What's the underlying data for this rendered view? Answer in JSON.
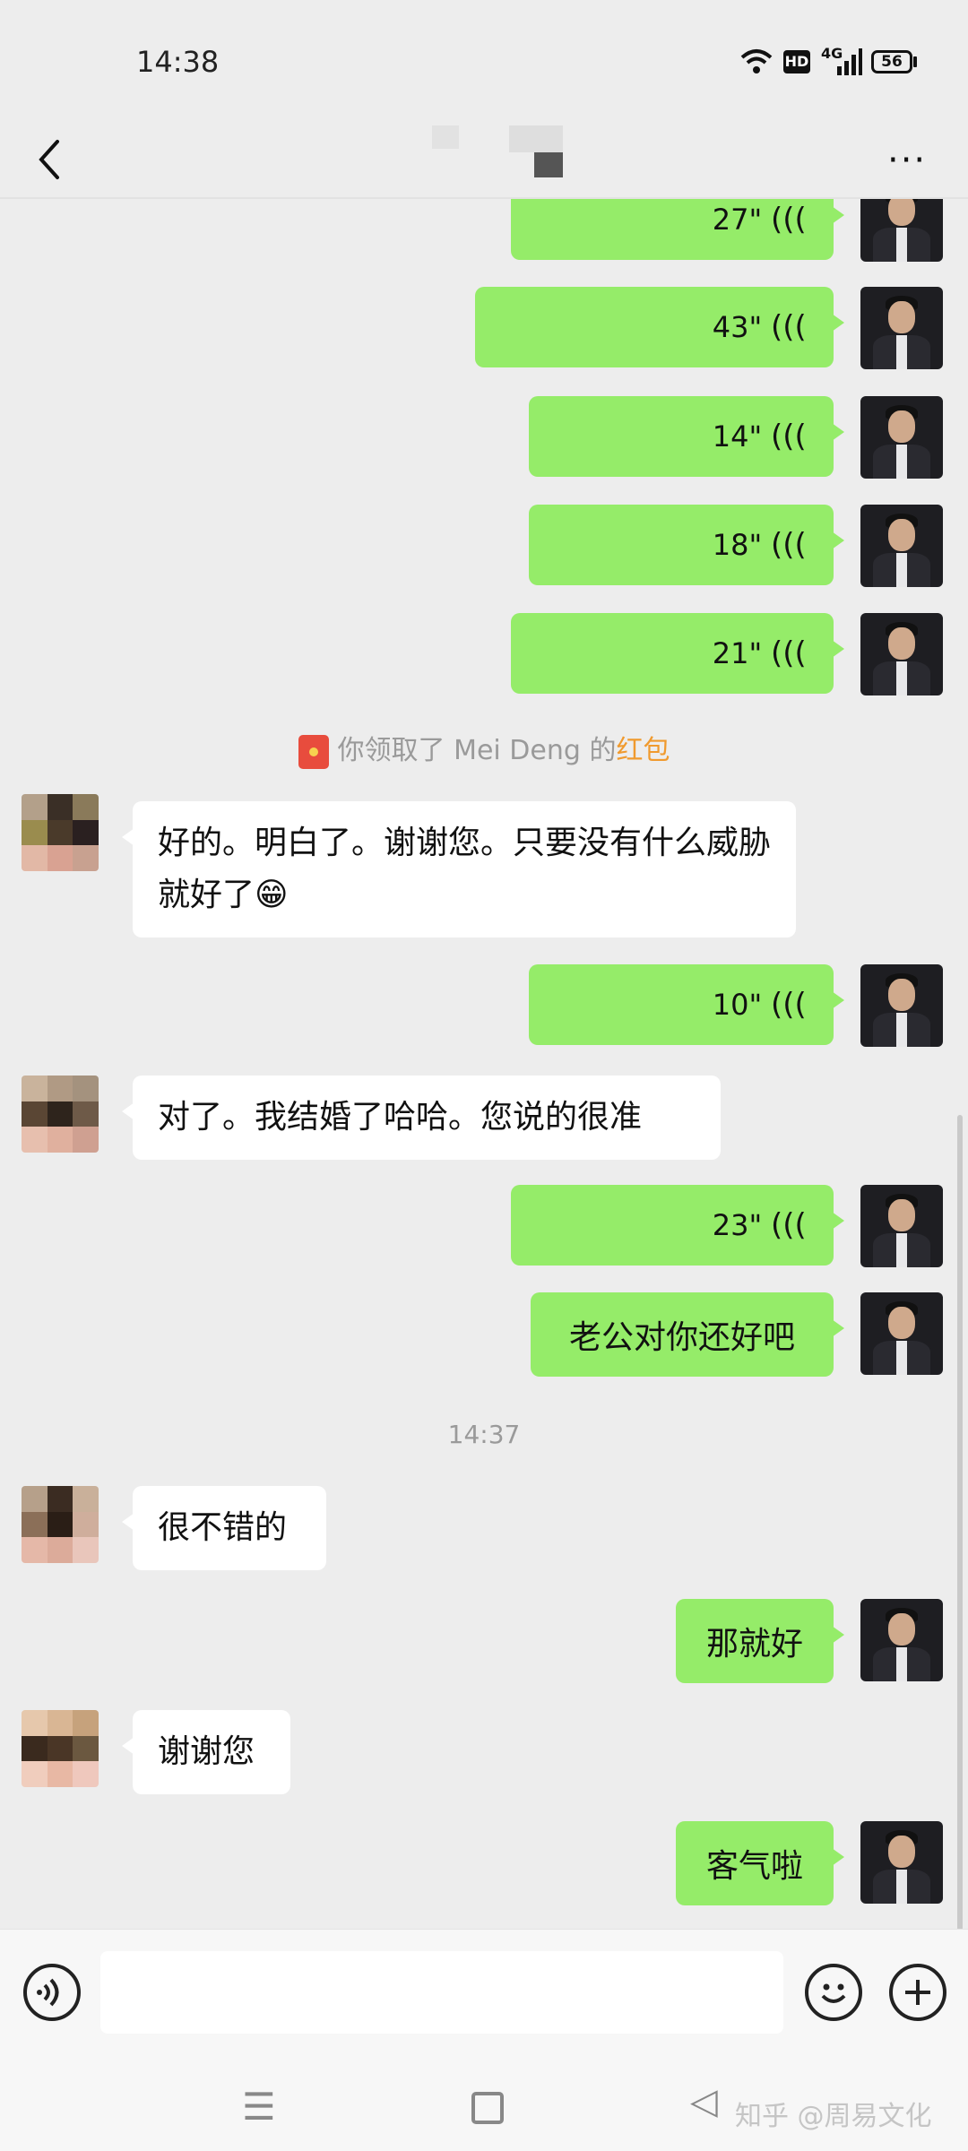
{
  "status_bar": {
    "time": "14:38",
    "hd": "HD",
    "network": "4G",
    "battery": "56"
  },
  "nav": {
    "back_icon": "chevron-left-icon",
    "more_icon": "more-dots-icon",
    "more_label": "···"
  },
  "messages": [
    {
      "side": "right",
      "type": "voice",
      "duration": "27\""
    },
    {
      "side": "right",
      "type": "voice",
      "duration": "43\""
    },
    {
      "side": "right",
      "type": "voice",
      "duration": "14\""
    },
    {
      "side": "right",
      "type": "voice",
      "duration": "18\""
    },
    {
      "side": "right",
      "type": "voice",
      "duration": "21\""
    },
    {
      "type": "system",
      "prefix": "你领取了 Mei Deng 的",
      "highlight": "红包"
    },
    {
      "side": "left",
      "type": "text",
      "text": "好的。明白了。谢谢您。只要没有什么威胁就好了😁"
    },
    {
      "side": "right",
      "type": "voice",
      "duration": "10\""
    },
    {
      "side": "left",
      "type": "text",
      "text": "对了。我结婚了哈哈。您说的很准"
    },
    {
      "side": "right",
      "type": "voice",
      "duration": "23\""
    },
    {
      "side": "right",
      "type": "text",
      "text": "老公对你还好吧"
    },
    {
      "type": "time",
      "text": "14:37"
    },
    {
      "side": "left",
      "type": "text",
      "text": "很不错的"
    },
    {
      "side": "right",
      "type": "text",
      "text": "那就好"
    },
    {
      "side": "left",
      "type": "text",
      "text": "谢谢您"
    },
    {
      "side": "right",
      "type": "text",
      "text": "客气啦"
    }
  ],
  "input_bar": {
    "voice_icon": "voice-input-icon",
    "emoji_icon": "emoji-icon",
    "plus_icon": "plus-icon",
    "placeholder": ""
  },
  "system_nav": {
    "menu_icon": "menu-icon",
    "home_icon": "home-icon",
    "back_icon": "back-triangle-icon",
    "menu_glyph": "☰",
    "back_glyph": "◁",
    "watermark": "知乎 @周易文化"
  },
  "colors": {
    "bubble_green": "#95ec69",
    "bubble_white": "#ffffff",
    "background": "#ededed",
    "red_packet_highlight": "#f09a2e"
  }
}
